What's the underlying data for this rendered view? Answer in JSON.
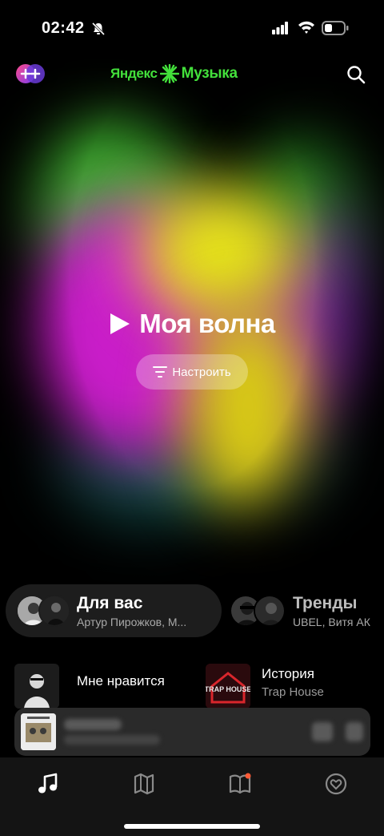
{
  "status_bar": {
    "time": "02:42"
  },
  "header": {
    "logo_part1": "Яндекс",
    "logo_part2": "Музыка"
  },
  "wave": {
    "title": "Моя волна",
    "tune_button": "Настроить"
  },
  "cards": {
    "for_you": {
      "title": "Для вас",
      "subtitle": "Артур Пирожков, М..."
    },
    "trends": {
      "title": "Тренды",
      "subtitle": "UBEL, Витя АК"
    }
  },
  "playlists": {
    "liked": {
      "title": "Мне нравится",
      "subtitle": ""
    },
    "history": {
      "title": "История",
      "subtitle": "Trap House",
      "cover_text": "TRAP HOUSE"
    }
  },
  "colors": {
    "accent_green": "#43e03b",
    "notification_dot": "#ff5a36"
  }
}
